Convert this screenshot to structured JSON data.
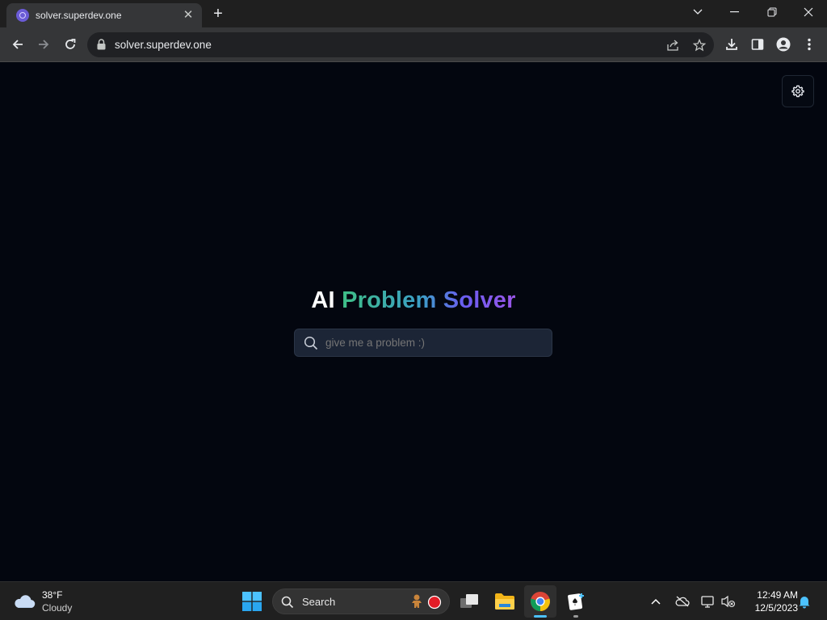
{
  "browser": {
    "tab": {
      "title": "solver.superdev.one",
      "favicon": "superdev-favicon-icon"
    },
    "new_tab_label": "+",
    "url": "solver.superdev.one"
  },
  "page": {
    "title_part1": "AI",
    "title_part2": "Problem Solver",
    "search": {
      "placeholder": "give me a problem :)"
    },
    "settings_icon": "gear-icon",
    "title_gradient": [
      "#3fbf86",
      "#3b9fc7",
      "#6a5df0",
      "#9b56e8"
    ]
  },
  "taskbar": {
    "weather": {
      "temp": "38°F",
      "condition": "Cloudy"
    },
    "search_label": "Search",
    "clock": {
      "time": "12:49 AM",
      "date": "12/5/2023"
    },
    "accent": "#4cc2ff"
  }
}
